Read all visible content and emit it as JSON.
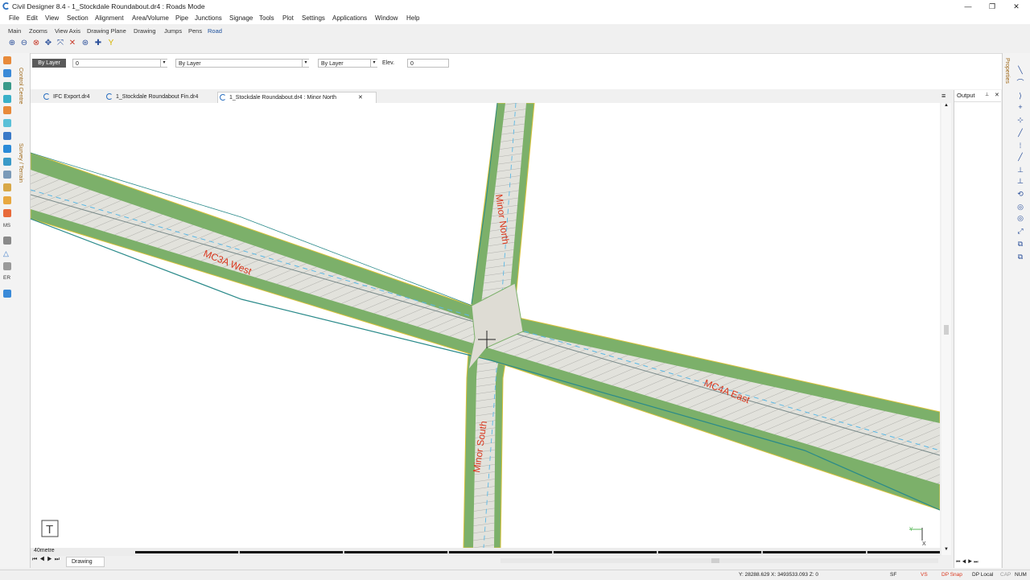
{
  "titlebar": {
    "title": "Civil Designer 8.4 - 1_Stockdale Roundabout.dr4 : Roads Mode",
    "minimize": "—",
    "restore": "❐",
    "close": "✕"
  },
  "menu": [
    "File",
    "Edit",
    "View",
    "Section",
    "Alignment",
    "Area/Volume",
    "Pipe",
    "Junctions",
    "Signage",
    "Tools",
    "Plot",
    "Settings",
    "Applications",
    "Window",
    "Help"
  ],
  "toolbar_tabs": [
    "Main",
    "Zooms",
    "View Axis",
    "Drawing Plane",
    "Drawing",
    "Jumps",
    "Pens",
    "Road"
  ],
  "properties_bar": {
    "layer_button": "By Layer",
    "layer_value": "0",
    "color_value": "By Layer",
    "linetype_value": "By Layer",
    "elev_label": "Elev.",
    "elev_value": "0"
  },
  "left_panel_labels": {
    "control_centre": "Control Centre",
    "survey_terrain": "Survey / Terrain",
    "ms_text": "MS",
    "er_text": "ER"
  },
  "doc_tabs": [
    {
      "label": "IFC Export.dr4",
      "active": false
    },
    {
      "label": "1_Stockdale Roundabout Fin.dr4",
      "active": false
    },
    {
      "label": "1_Stockdale Roundabout.dr4 : Minor North",
      "active": true,
      "close": "✕"
    }
  ],
  "canvas": {
    "road_labels": {
      "west": "MC3A West",
      "east": "MC4A East",
      "north": "Minor North",
      "south": "Minor South"
    },
    "ucs_icon": {
      "y_label": "Y",
      "x_label": "X"
    },
    "text_tool_icon": "T"
  },
  "scale_label": "40metre",
  "sheet_tab": "Drawing",
  "output_panel": {
    "title": "Output",
    "pin": "📌",
    "close": "✕"
  },
  "right_panel_label": "Properties",
  "status": {
    "coords": "Y: 28288.629 X: 3493533.093 Z: 0",
    "sf": "SF",
    "vs": "VS",
    "dp_snap": "DP Snap",
    "dp_local": "DP Local",
    "cap": "CAP",
    "num": "NUM"
  },
  "colors": {
    "road_green": "#7cb06a",
    "road_surface": "#e2e2dc",
    "label_red": "#d9371e",
    "centerline_blue": "#5ab8e6",
    "edge_yellow": "#d8c23a",
    "accent_orange": "#f4a040"
  }
}
